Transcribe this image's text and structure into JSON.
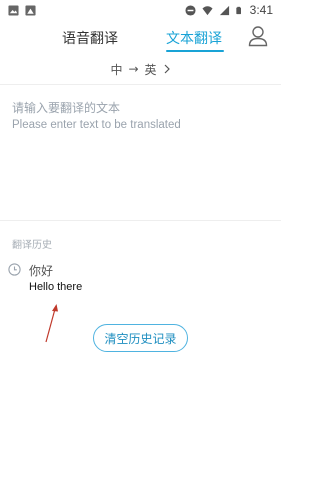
{
  "status_bar": {
    "time": "3:41",
    "left_icons": [
      "image-icon",
      "photo-icon"
    ],
    "right_icons": [
      "do-not-disturb-icon",
      "wifi-icon",
      "signal-icon",
      "battery-icon"
    ]
  },
  "header": {
    "tabs": [
      {
        "label": "语音翻译",
        "active": false
      },
      {
        "label": "文本翻译",
        "active": true
      }
    ],
    "accent_color": "#19a3d6",
    "profile_icon": "user-icon"
  },
  "language_bar": {
    "source": "中",
    "arrow": "→",
    "target": "英",
    "chevron": ">"
  },
  "input": {
    "placeholder_cn": "请输入要翻译的文本",
    "placeholder_en": "Please enter text to be translated"
  },
  "history": {
    "title": "翻译历史",
    "items": [
      {
        "source": "你好",
        "target": "Hello there",
        "icon": "clock-icon"
      }
    ],
    "clear_label": "清空历史记录"
  }
}
